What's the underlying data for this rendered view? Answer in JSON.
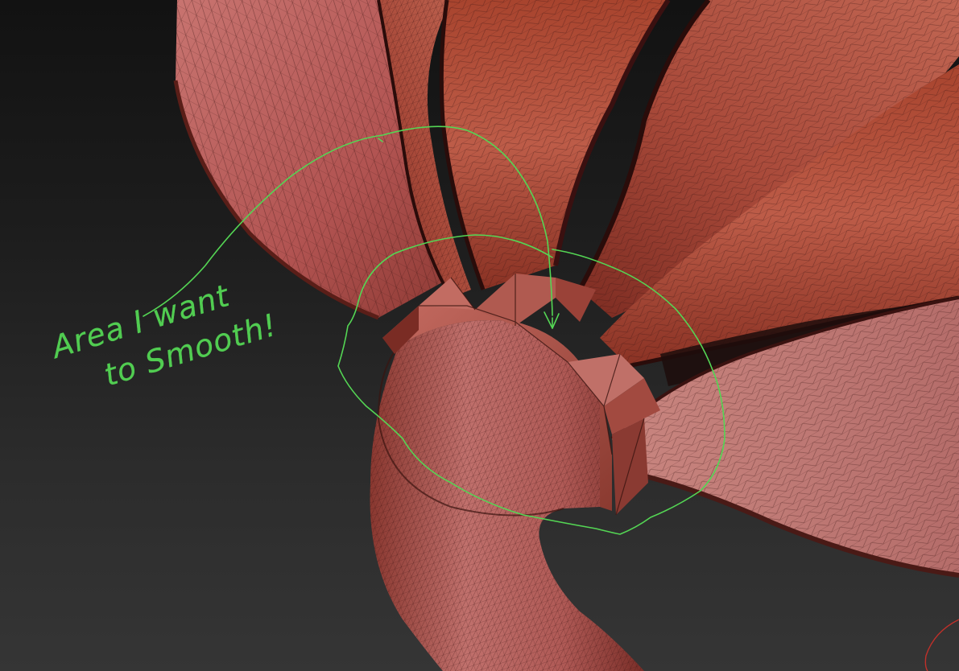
{
  "annotation": {
    "line1": "Area I want",
    "line2": "to Smooth!",
    "color": "#54d654"
  },
  "scene": {
    "background_top": "#121212",
    "background_bottom": "#353535",
    "mesh_fill": "#b4585a",
    "mesh_shadow": "#7a2e28",
    "mesh_highlight": "#d88a88",
    "wire_color": "#3a1412",
    "gizmo_color": "#c0302a"
  }
}
